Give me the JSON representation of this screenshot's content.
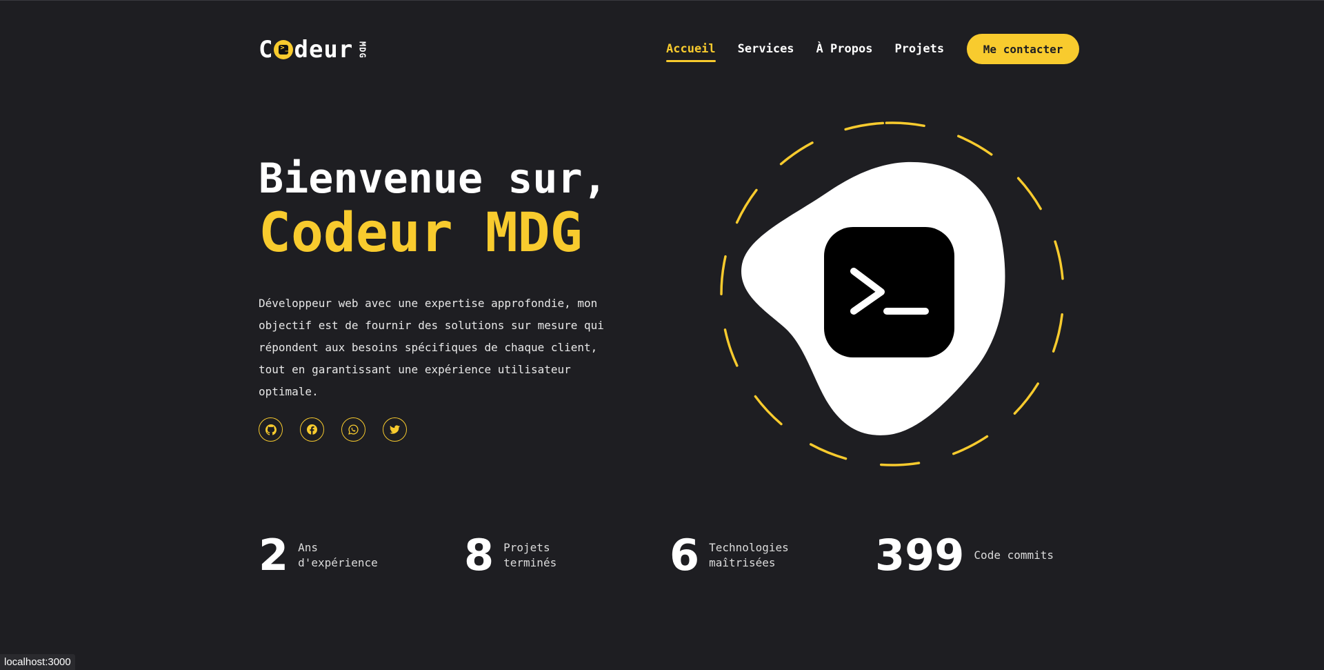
{
  "logo": {
    "text_before": "C",
    "text_after": "deur",
    "sub": "MDG"
  },
  "nav": {
    "items": [
      {
        "label": "Accueil"
      },
      {
        "label": "Services"
      },
      {
        "label": "À Propos"
      },
      {
        "label": "Projets"
      }
    ],
    "contact_label": "Me contacter"
  },
  "hero": {
    "line1": "Bienvenue sur,",
    "line2": "Codeur MDG",
    "description": "Développeur web avec une expertise approfondie, mon objectif est de fournir des solutions sur mesure qui répondent aux besoins spécifiques de chaque client, tout en garantissant une expérience utilisateur optimale."
  },
  "socials": [
    "github-icon",
    "facebook-icon",
    "whatsapp-icon",
    "twitter-icon"
  ],
  "stats": [
    {
      "value": "2",
      "label": "Ans d'expérience"
    },
    {
      "value": "8",
      "label": "Projets terminés"
    },
    {
      "value": "6",
      "label": "Technologies maîtrisées"
    },
    {
      "value": "399",
      "label": "Code commits"
    }
  ],
  "status_bar": {
    "url": "localhost:3000"
  },
  "colors": {
    "accent": "#f8cb2e",
    "background": "#1e1e22"
  }
}
